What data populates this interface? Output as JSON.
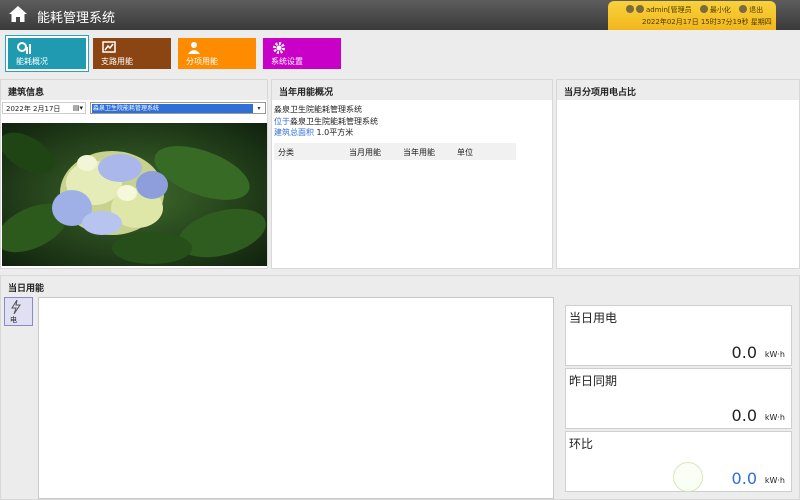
{
  "header": {
    "title": "能耗管理系统",
    "user": "admin[管理员",
    "minimize": "最小化",
    "logout": "退出",
    "datetime": "2022年02月17日 15时37分19秒 星期四"
  },
  "nav": [
    {
      "label": "能耗概况",
      "color": "#1f9ab0",
      "icon": "chart-icon",
      "active": true
    },
    {
      "label": "支路用能",
      "color": "#8b4513",
      "icon": "branch-chart-icon",
      "active": false
    },
    {
      "label": "分项用能",
      "color": "#ff8c00",
      "icon": "user-icon",
      "active": false
    },
    {
      "label": "系统设置",
      "color": "#c800c8",
      "icon": "gear-icon",
      "active": false
    }
  ],
  "building": {
    "heading": "建筑信息",
    "date": "2022年 2月17日",
    "selected": "淼泉卫生院能耗管理系统"
  },
  "year_summary": {
    "heading": "当年用能概况",
    "name": "淼泉卫生院能耗管理系统",
    "location_label": "位于",
    "location": "淼泉卫生院能耗管理系统",
    "area_label": "建筑总面积",
    "area": "1.0平方米",
    "columns": [
      "分类",
      "当月用能",
      "当年用能",
      "单位"
    ]
  },
  "month_ratio": {
    "heading": "当月分项用电占比"
  },
  "today": {
    "heading": "当日用能",
    "side_label": "电",
    "cards": [
      {
        "title": "当日用电",
        "value": "0.0",
        "unit": "kW·h"
      },
      {
        "title": "昨日同期",
        "value": "0.0",
        "unit": "kW·h"
      },
      {
        "title": "环比",
        "value": "0.0",
        "unit": "kW·h"
      }
    ]
  }
}
